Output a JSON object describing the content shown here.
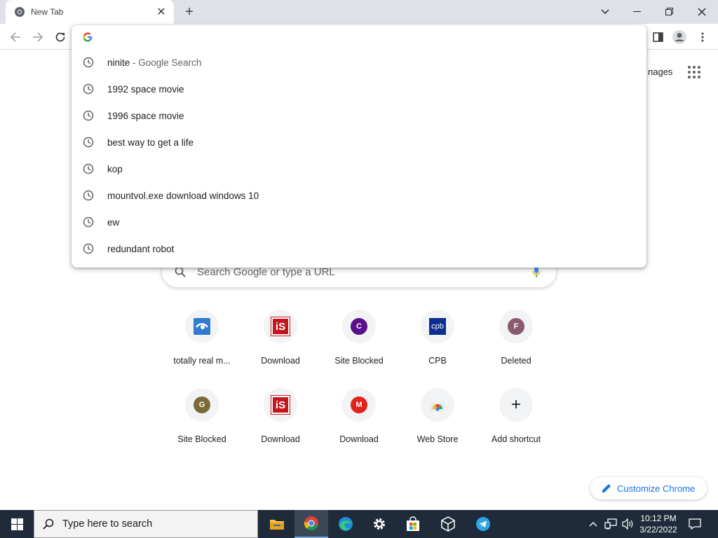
{
  "tab": {
    "title": "New Tab",
    "close": "✕",
    "new_tab": "+"
  },
  "window_controls": {
    "dropdown": "chevron-down-icon",
    "minimize": "minimize-icon",
    "restore": "restore-icon",
    "close": "close-icon"
  },
  "omnibox": {
    "value": "",
    "suggestions": [
      {
        "text": "ninite",
        "sub": " - Google Search"
      },
      {
        "text": "1992 space movie",
        "sub": ""
      },
      {
        "text": "1996 space movie",
        "sub": ""
      },
      {
        "text": "best way to get a life",
        "sub": ""
      },
      {
        "text": "kop",
        "sub": ""
      },
      {
        "text": "mountvol.exe download windows 10",
        "sub": ""
      },
      {
        "text": "ew",
        "sub": ""
      },
      {
        "text": "redundant robot",
        "sub": ""
      }
    ]
  },
  "ntp": {
    "images_link": "nages",
    "search_placeholder": "Search Google or type a URL",
    "shortcuts": [
      {
        "label": "totally real m...",
        "icon": "blue-eye-icon"
      },
      {
        "label": "Download",
        "icon": "is-logo-icon",
        "glyph": "iS"
      },
      {
        "label": "Site Blocked",
        "icon": "letter-c-icon",
        "glyph": "C",
        "color": "#5b0f8c"
      },
      {
        "label": "CPB",
        "icon": "cpb-logo-icon",
        "glyph": "cpb"
      },
      {
        "label": "Deleted",
        "icon": "letter-f-icon",
        "glyph": "F",
        "color": "#8a5a6e"
      },
      {
        "label": "Site Blocked",
        "icon": "letter-g-icon",
        "glyph": "G",
        "color": "#7a6a3a"
      },
      {
        "label": "Download",
        "icon": "is-logo-icon",
        "glyph": "iS"
      },
      {
        "label": "Download",
        "icon": "mega-icon",
        "glyph": "M"
      },
      {
        "label": "Web Store",
        "icon": "web-store-icon"
      },
      {
        "label": "Add shortcut",
        "icon": "plus-icon",
        "glyph": "+"
      }
    ],
    "customize": "Customize Chrome"
  },
  "taskbar": {
    "search_placeholder": "Type here to search",
    "time": "10:12 PM",
    "date": "3/22/2022",
    "apps": [
      "file-explorer-icon",
      "chrome-icon",
      "edge-icon",
      "settings-icon",
      "store-icon",
      "3d-viewer-icon",
      "telegram-icon"
    ]
  },
  "colors": {
    "accent": "#1a73e8",
    "taskbar": "#1f2b3a",
    "tabstrip": "#dee1e6"
  }
}
